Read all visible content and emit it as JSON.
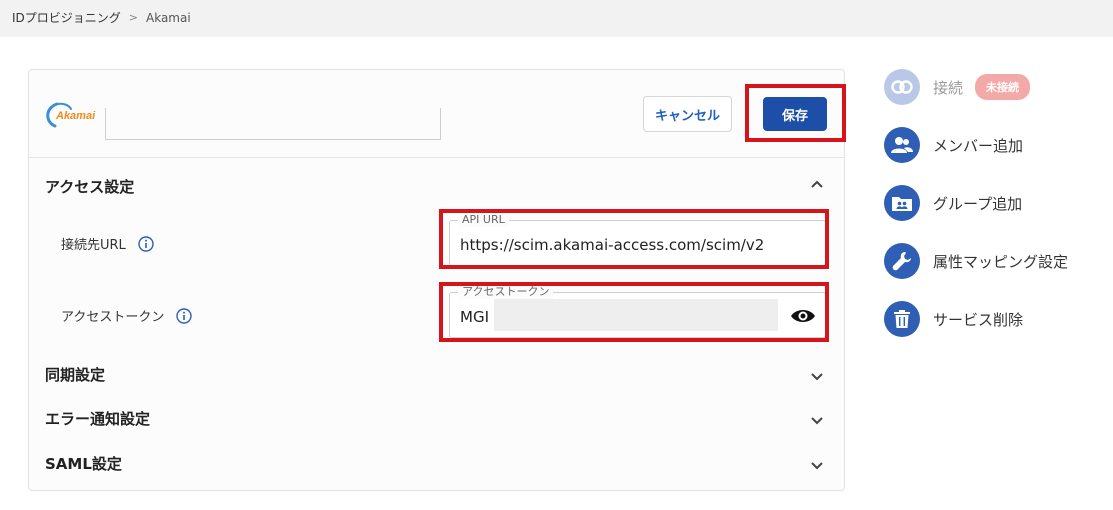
{
  "breadcrumb": {
    "parent": "IDプロビジョニング",
    "separator": ">",
    "current": "Akamai"
  },
  "header": {
    "logo_text": "Akamai",
    "cancel_label": "キャンセル",
    "save_label": "保存"
  },
  "sections": {
    "access": {
      "title": "アクセス設定",
      "url_label": "接続先URL",
      "url_field_label": "API URL",
      "url_value": "https://scim.akamai-access.com/scim/v2",
      "token_label": "アクセストークン",
      "token_field_label": "アクセストークン",
      "token_value": "MGI"
    },
    "sync": {
      "title": "同期設定"
    },
    "error": {
      "title": "エラー通知設定"
    },
    "saml": {
      "title": "SAML設定"
    }
  },
  "sidebar": {
    "connect": {
      "label": "接続",
      "badge": "未接続",
      "icon": "link-icon"
    },
    "add_member": {
      "label": "メンバー追加",
      "icon": "users-icon"
    },
    "add_group": {
      "label": "グループ追加",
      "icon": "group-folder-icon"
    },
    "attr_mapping": {
      "label": "属性マッピング設定",
      "icon": "wrench-icon"
    },
    "delete_service": {
      "label": "サービス削除",
      "icon": "trash-icon"
    }
  },
  "colors": {
    "primary": "#1d4fa8",
    "icon_bg": "#2e5fb5",
    "highlight": "#d6141c",
    "badge": "#f4a9a9",
    "logo": "#ef8a1c"
  }
}
